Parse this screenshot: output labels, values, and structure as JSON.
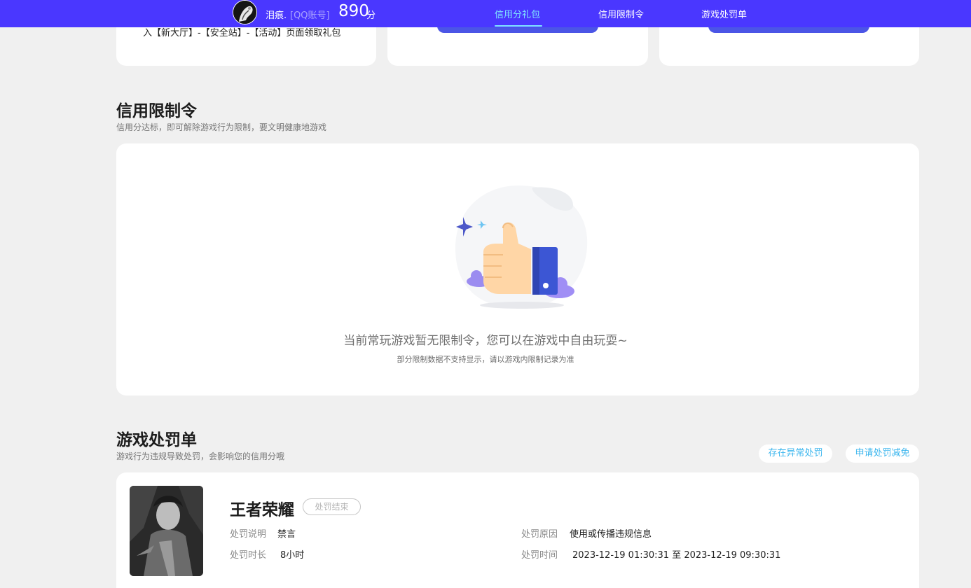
{
  "header": {
    "user_name": "泪痕.",
    "account_type": "[QQ账号]",
    "score": "890",
    "score_unit": "分",
    "tabs": [
      {
        "label": "信用分礼包",
        "active": true
      },
      {
        "label": "信用限制令",
        "active": false
      },
      {
        "label": "游戏处罚单",
        "active": false
      }
    ]
  },
  "gift_cards": {
    "first_card_text": "入【新大厅】-【安全站】-【活动】页面领取礼包"
  },
  "restriction": {
    "title": "信用限制令",
    "subtitle": "信用分达标，即可解除游戏行为限制，要文明健康地游戏",
    "empty_main": "当前常玩游戏暂无限制令，您可以在游戏中自由玩耍~",
    "empty_sub": "部分限制数据不支持显示，请以游戏内限制记录为准"
  },
  "punishment": {
    "title": "游戏处罚单",
    "subtitle": "游戏行为违规导致处罚，会影响您的信用分哦",
    "buttons": {
      "abnormal": "存在异常处罚",
      "reduce": "申请处罚减免"
    },
    "record": {
      "game": "王者荣耀",
      "status": "处罚结束",
      "desc_label": "处罚说明",
      "desc_value": "禁言",
      "reason_label": "处罚原因",
      "reason_value": "使用或传播违规信息",
      "duration_label": "处罚时长",
      "duration_value": "8小时",
      "time_label": "处罚时间",
      "time_value": "2023-12-19 01:30:31 至 2023-12-19 09:30:31"
    }
  },
  "colors": {
    "topbar": "#4a37ff",
    "active_tab": "#7fe6ff",
    "pill_text": "#3bb6ee",
    "gift_button": "#4b55e6"
  }
}
